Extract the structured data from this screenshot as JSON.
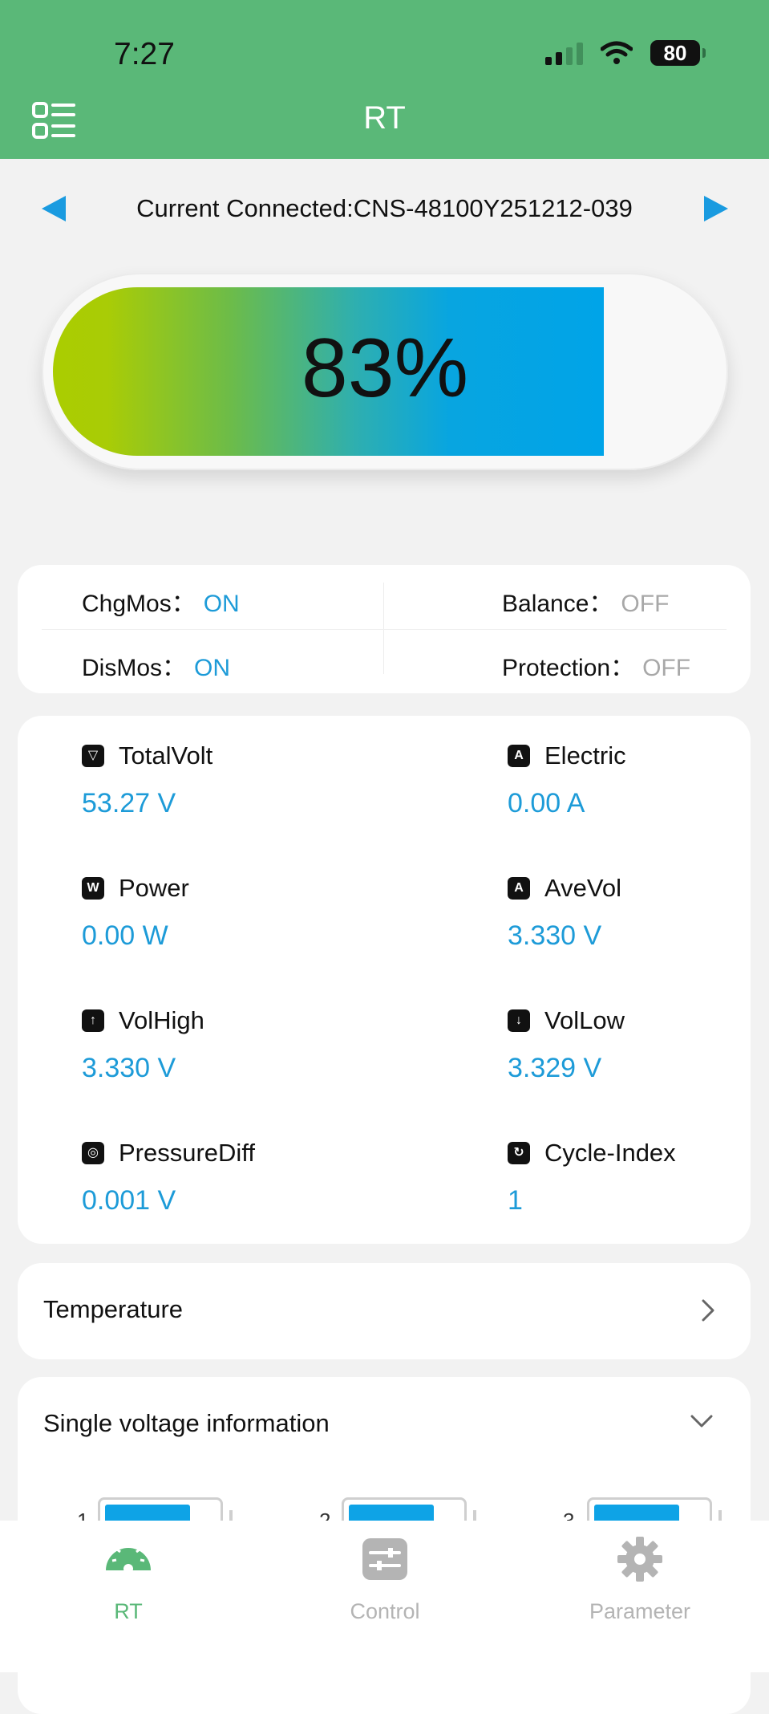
{
  "status_bar": {
    "time": "7:27",
    "battery": "80"
  },
  "header": {
    "title": "RT"
  },
  "connection": {
    "label": "Current Connected:CNS-48100Y251212-039"
  },
  "soc": {
    "text": "83%",
    "percent": 83
  },
  "status": {
    "chgmos_label": "ChgMos：",
    "chgmos_value": "ON",
    "dismos_label": "DisMos：",
    "dismos_value": "ON",
    "balance_label": "Balance：",
    "balance_value": "OFF",
    "protection_label": "Protection：",
    "protection_value": "OFF"
  },
  "metrics": [
    {
      "label": "TotalVolt",
      "value": "53.27 V",
      "icon": "voltage-icon"
    },
    {
      "label": "Electric",
      "value": "0.00 A",
      "icon": "current-icon"
    },
    {
      "label": "Power",
      "value": "0.00 W",
      "icon": "power-icon"
    },
    {
      "label": "AveVol",
      "value": "3.330 V",
      "icon": "average-icon"
    },
    {
      "label": "VolHigh",
      "value": "3.330 V",
      "icon": "high-voltage-icon"
    },
    {
      "label": "VolLow",
      "value": "3.329 V",
      "icon": "low-voltage-icon"
    },
    {
      "label": "PressureDiff",
      "value": "0.001 V",
      "icon": "pressure-diff-icon"
    },
    {
      "label": "Cycle-Index",
      "value": "1",
      "icon": "cycle-icon"
    }
  ],
  "temperature": {
    "title": "Temperature"
  },
  "single_voltage": {
    "title": "Single voltage information",
    "cells": [
      {
        "num": "1"
      },
      {
        "num": "2"
      },
      {
        "num": "3"
      }
    ]
  },
  "tabs": [
    {
      "label": "RT",
      "active": true,
      "icon": "gauge-icon"
    },
    {
      "label": "Control",
      "active": false,
      "icon": "sliders-icon"
    },
    {
      "label": "Parameter",
      "active": false,
      "icon": "gear-icon"
    }
  ],
  "colors": {
    "header_green": "#5ab878",
    "accent_blue": "#1d9bd8",
    "active_tab": "#5ab878",
    "inactive_tab": "#b4b4b4",
    "off_gray": "#a8a8a8"
  }
}
